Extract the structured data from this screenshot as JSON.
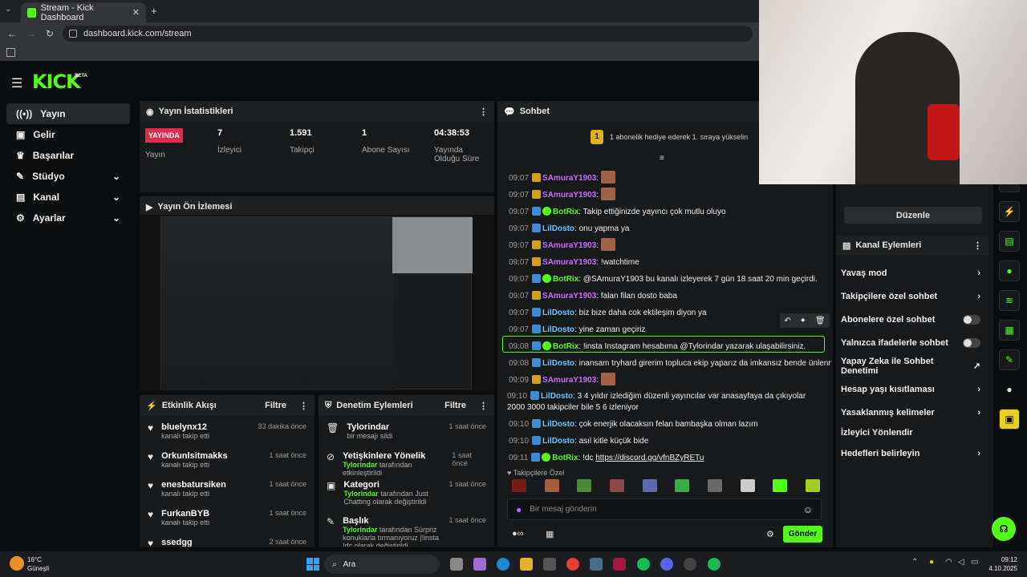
{
  "browser": {
    "tab_title": "Stream - Kick Dashboard",
    "url": "dashboard.kick.com/stream"
  },
  "brand": {
    "logo": "KICK",
    "beta": "BETA",
    "accent": "#53fc18"
  },
  "sidebar": {
    "items": [
      {
        "label": "Yayın",
        "icon": "broadcast-icon"
      },
      {
        "label": "Gelir",
        "icon": "wallet-icon"
      },
      {
        "label": "Başarılar",
        "icon": "trophy-icon"
      },
      {
        "label": "Stüdyo",
        "icon": "studio-icon"
      },
      {
        "label": "Kanal",
        "icon": "channel-icon"
      },
      {
        "label": "Ayarlar",
        "icon": "gear-icon"
      }
    ]
  },
  "stats": {
    "title": "Yayın İstatistikleri",
    "live_badge": "YAYINDA",
    "live_label": "Yayın",
    "items": [
      {
        "value": "7",
        "label": "İzleyici"
      },
      {
        "value": "1.591",
        "label": "Takipçi"
      },
      {
        "value": "1",
        "label": "Abone Sayısı"
      },
      {
        "value": "04:38:53",
        "label": "Yayında Olduğu Süre"
      }
    ]
  },
  "preview": {
    "title": "Yayın Ön İzlemesi"
  },
  "activity": {
    "title": "Etkinlik Akışı",
    "filter": "Filtre",
    "items": [
      {
        "name": "bluelynx12",
        "desc": "kanalı takip etti",
        "time": "33 dakika önce"
      },
      {
        "name": "Orkunlsitmakks",
        "desc": "kanalı takip etti",
        "time": "1 saat önce"
      },
      {
        "name": "enesbatursiken",
        "desc": "kanalı takip etti",
        "time": "1 saat önce"
      },
      {
        "name": "FurkanBYB",
        "desc": "kanalı takip etti",
        "time": "1 saat önce"
      },
      {
        "name": "ssedgg",
        "desc": "",
        "time": "2 saat önce"
      }
    ]
  },
  "moderation": {
    "title": "Denetim Eylemleri",
    "filter": "Filtre",
    "items": [
      {
        "title": "Tylorindar",
        "line1": "bir mesajı sildi",
        "hl": "",
        "line2": "",
        "time": "1 saat önce"
      },
      {
        "title": "Yetişkinlere Yönelik",
        "line1": "",
        "hl": "Tylorindar",
        "line2": "tarafından etkinleştirildi",
        "time": "1 saat önce"
      },
      {
        "title": "Kategori",
        "line1": "",
        "hl": "Tylorindar",
        "line2": "tarafından Just Chatting olarak değiştirildi",
        "time": "1 saat önce"
      },
      {
        "title": "Başlık",
        "line1": "",
        "hl": "Tylorindar",
        "line2": "tarafından Sürpriz konuklarla tırmanıyoruz |!insta !dc olarak değiştirildi",
        "time": "1 saat önce"
      }
    ]
  },
  "chat": {
    "title": "Sohbet",
    "gift_text": "1 abonelik hediye ederek 1. sıraya yükselin",
    "gift_rank": "1",
    "messages": [
      {
        "t": "09:07",
        "u": "SAmuraY1903",
        "c": "pink",
        "m": "",
        "emote": true
      },
      {
        "t": "09:07",
        "u": "SAmuraY1903",
        "c": "pink",
        "m": "",
        "emote": true
      },
      {
        "t": "09:07",
        "u": "BotRix",
        "c": "green",
        "m": "Takip ettiğinizde yayıncı çok mutlu oluyo"
      },
      {
        "t": "09:07",
        "u": "LilDosto",
        "c": "blue",
        "m": "onu yapma ya"
      },
      {
        "t": "09:07",
        "u": "SAmuraY1903",
        "c": "pink",
        "m": "",
        "emote": true
      },
      {
        "t": "09:07",
        "u": "SAmuraY1903",
        "c": "pink",
        "m": "!watchtime"
      },
      {
        "t": "09:07",
        "u": "BotRix",
        "c": "green",
        "m": "@SAmuraY1903 bu kanalı izleyerek 7 gün 18 saat 20 min geçirdi."
      },
      {
        "t": "09:07",
        "u": "SAmuraY1903",
        "c": "pink",
        "m": "falan filan dosto baba"
      },
      {
        "t": "09:07",
        "u": "LilDosto",
        "c": "blue",
        "m": "biz bize daha cok ektileşim diyon ya"
      },
      {
        "t": "09:07",
        "u": "LilDosto",
        "c": "blue",
        "m": "yine zaman geçiriz"
      },
      {
        "t": "09:08",
        "u": "BotRix",
        "c": "green",
        "m": "!insta Instagram hesabıma @Tylorindar yazarak ulaşabilirsiniz."
      },
      {
        "t": "09:08",
        "u": "LilDosto",
        "c": "blue",
        "m": "inansam tryhard girerim topluca ekip yaparız da imkansız bende ünlenmek"
      },
      {
        "t": "09:09",
        "u": "SAmuraY1903",
        "c": "pink",
        "m": "",
        "emote": true
      },
      {
        "t": "09:10",
        "u": "LilDosto",
        "c": "blue",
        "m": "3 4 yıldır izlediğim düzenli yayıncılar var anasayfaya da çıkıyolar 2000 3000 takipciler bile 5 6 izleniyor"
      },
      {
        "t": "09:10",
        "u": "LilDosto",
        "c": "blue",
        "m": "çok enerjik olacaksın felan bambaşka olman lazım"
      },
      {
        "t": "09:10",
        "u": "LilDosto",
        "c": "blue",
        "m": "asıl kitle küçük bide"
      },
      {
        "t": "09:11",
        "u": "BotRix",
        "c": "green",
        "m": "!dc ",
        "link": "https://discord.gg/vfnBZyRETu"
      }
    ],
    "followers_label": "Takipçilere Özel",
    "input_placeholder": "Bir mesaj gönderin",
    "send": "Gönder"
  },
  "right_panel": {
    "edit": "Düzenle",
    "title": "Kanal Eylemleri",
    "items": [
      {
        "label": "Yavaş mod",
        "ctrl": "chevron"
      },
      {
        "label": "Takipçilere özel sohbet",
        "ctrl": "chevron"
      },
      {
        "label": "Abonelere özel sohbet",
        "ctrl": "toggle"
      },
      {
        "label": "Yalnızca ifadelerle sohbet",
        "ctrl": "toggle"
      },
      {
        "label": "Yapay Zeka ile Sohbet Denetimi",
        "ctrl": "external"
      },
      {
        "label": "Hesap yaşı kısıtlaması",
        "ctrl": "chevron"
      },
      {
        "label": "Yasaklanmış kelimeler",
        "ctrl": "chevron"
      },
      {
        "label": "İzleyici Yönlendir",
        "ctrl": "none"
      },
      {
        "label": "Hedefleri belirleyin",
        "ctrl": "chevron"
      }
    ]
  },
  "taskbar": {
    "temp": "16°C",
    "weather": "Güneşli",
    "search": "Ara",
    "time": "09:12",
    "date": "4.10.2025"
  }
}
